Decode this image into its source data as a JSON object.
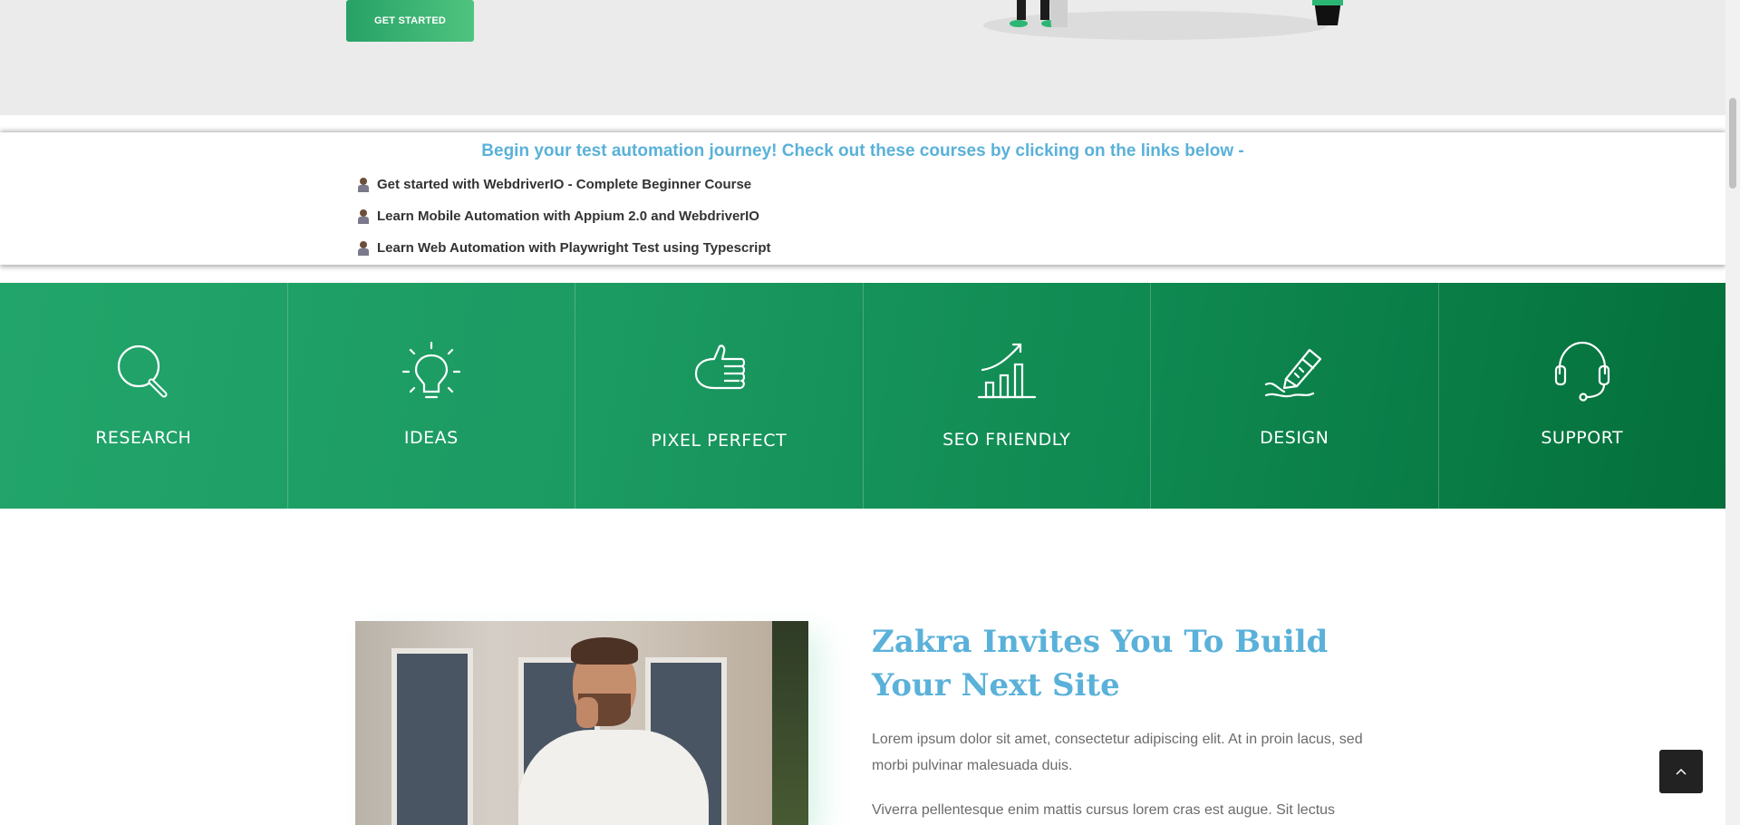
{
  "hero": {
    "button_label": "GET STARTED"
  },
  "courses": {
    "title": "Begin your test automation journey! Check out these courses by clicking on the links below -",
    "links": [
      {
        "label": "Get started with WebdriverIO - Complete Beginner Course",
        "icon": "person-icon"
      },
      {
        "label": "Learn Mobile Automation with Appium 2.0 and WebdriverIO",
        "icon": "person-icon"
      },
      {
        "label": "Learn Web Automation with Playwright Test using Typescript",
        "icon": "person-icon"
      }
    ]
  },
  "features": [
    {
      "label": "RESEARCH",
      "icon": "magnifier-icon"
    },
    {
      "label": "IDEAS",
      "icon": "lightbulb-icon"
    },
    {
      "label": "PIXEL PERFECT",
      "icon": "thumbs-up-icon"
    },
    {
      "label": "SEO FRIENDLY",
      "icon": "bar-chart-icon"
    },
    {
      "label": "DESIGN",
      "icon": "pen-icon"
    },
    {
      "label": "SUPPORT",
      "icon": "headset-icon"
    }
  ],
  "about": {
    "title": "Zakra Invites You To Build Your Next Site",
    "paragraph1": "Lorem ipsum dolor sit amet, consectetur adipiscing elit. At in proin lacus, sed morbi pulvinar malesuada duis.",
    "paragraph2": "Viverra pellentesque enim mattis cursus lorem cras est augue. Sit lectus"
  },
  "scroll_top": {
    "icon": "chevron-up-icon"
  },
  "colors": {
    "accent_blue": "#5ab1d9",
    "button_green": "#27a166",
    "band_green_start": "#22a56a",
    "band_green_end": "#046f3b"
  }
}
